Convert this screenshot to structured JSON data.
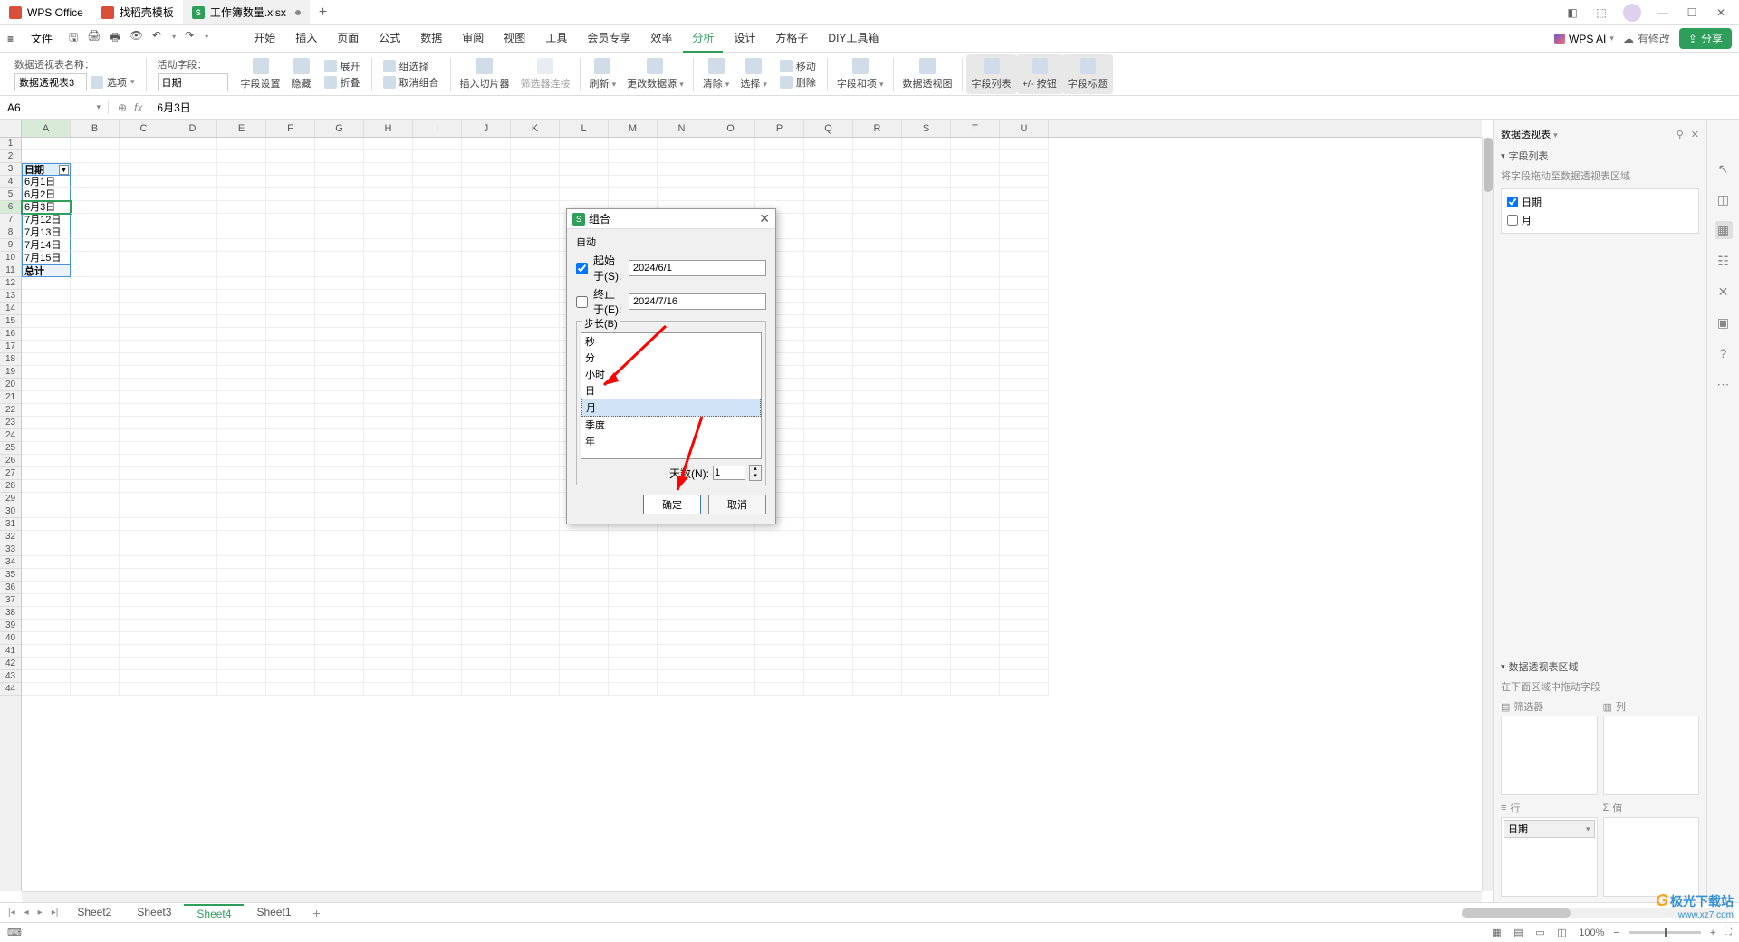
{
  "titlebar": {
    "tab_wps": "WPS Office",
    "tab_template": "找稻壳模板",
    "tab_file": "工作簿数量.xlsx"
  },
  "menubar": {
    "file": "文件",
    "tabs": [
      "开始",
      "插入",
      "页面",
      "公式",
      "数据",
      "审阅",
      "视图",
      "工具",
      "会员专享",
      "效率",
      "分析",
      "设计",
      "方格子",
      "DIY工具箱"
    ],
    "active_tab_index": 10,
    "ai": "WPS AI",
    "edit_badge": "有修改",
    "share": "分享"
  },
  "ribbon": {
    "name_label": "数据透视表名称：",
    "name_value": "数据透视表3",
    "options": "选项",
    "active_field_label": "活动字段：",
    "active_field_value": "日期",
    "field_settings": "字段设置",
    "hide": "隐藏",
    "expand": "展开",
    "collapse": "折叠",
    "group_sel": "组选择",
    "ungroup": "取消组合",
    "slicer": "插入切片器",
    "filter_conn": "筛选器连接",
    "refresh": "刷新",
    "change_src": "更改数据源",
    "clear": "清除",
    "select": "选择",
    "move": "移动",
    "delete": "删除",
    "field_items": "字段和项",
    "pivot_chart": "数据透视图",
    "field_list": "字段列表",
    "pm_btn": "+/- 按钮",
    "field_headers": "字段标题"
  },
  "formula": {
    "cell_ref": "A6",
    "value": "6月3日"
  },
  "grid": {
    "cols": [
      "A",
      "B",
      "C",
      "D",
      "E",
      "F",
      "G",
      "H",
      "I",
      "J",
      "K",
      "L",
      "M",
      "N",
      "O",
      "P",
      "Q",
      "R",
      "S",
      "T",
      "U"
    ],
    "header_cell": "日期",
    "data": [
      "6月1日",
      "6月2日",
      "6月3日",
      "7月12日",
      "7月13日",
      "7月14日",
      "7月15日"
    ],
    "total": "总计",
    "active_row_idx": 5
  },
  "dialog": {
    "title": "组合",
    "auto": "自动",
    "start_label": "起始于(S):",
    "start_value": "2024/6/1",
    "end_label": "终止于(E):",
    "end_value": "2024/7/16",
    "step_label": "步长(B)",
    "items": [
      "秒",
      "分",
      "小时",
      "日",
      "月",
      "季度",
      "年"
    ],
    "selected_idx": 4,
    "days_label": "天数(N):",
    "days_value": "1",
    "ok": "确定",
    "cancel": "取消"
  },
  "rpanel": {
    "title": "数据透视表",
    "sec_fields": "字段列表",
    "hint_fields": "将字段拖动至数据透视表区域",
    "field_date": "日期",
    "field_month": "月",
    "sec_areas": "数据透视表区域",
    "hint_areas": "在下面区域中拖动字段",
    "filters": "筛选器",
    "cols": "列",
    "rows": "行",
    "values": "值",
    "row_chip": "日期"
  },
  "sheets": {
    "tabs": [
      "Sheet2",
      "Sheet3",
      "Sheet4",
      "Sheet1"
    ],
    "active_idx": 2
  },
  "statusbar": {
    "zoom": "100%"
  },
  "watermark": {
    "brand": "极光下载站",
    "url": "www.xz7.com"
  }
}
